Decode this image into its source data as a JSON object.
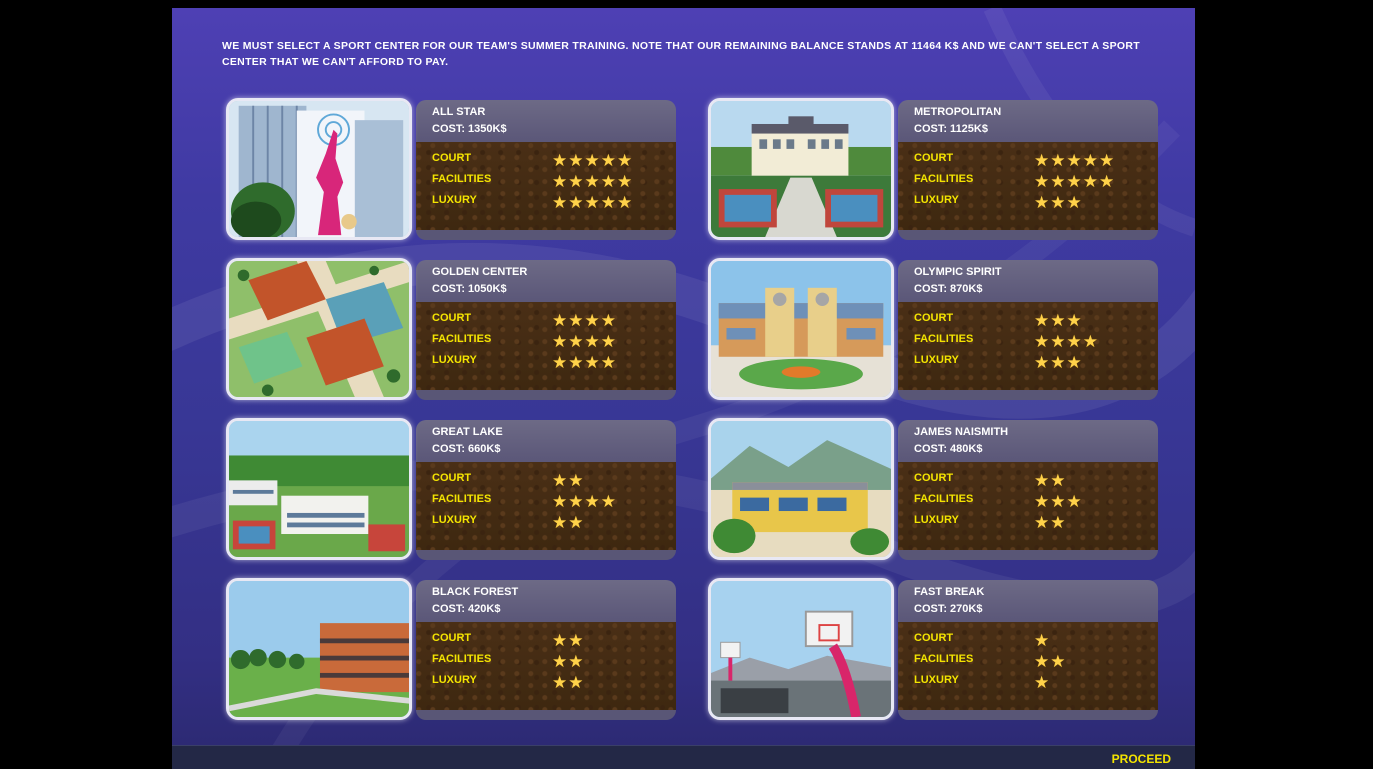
{
  "intro_text": "WE MUST SELECT A SPORT CENTER FOR OUR TEAM'S SUMMER TRAINING.  NOTE THAT OUR REMAINING BALANCE STANDS AT 11464 K$ AND WE CAN'T SELECT A SPORT CENTER THAT WE CAN'T AFFORD TO PAY.",
  "row_labels": {
    "court": "COURT",
    "facilities": "FACILITIES",
    "luxury": "LUXURY"
  },
  "centers": [
    {
      "name": "ALL STAR",
      "cost": "COST: 1350K$",
      "court": "★★★★★",
      "facilities": "★★★★★",
      "luxury": "★★★★★"
    },
    {
      "name": "METROPOLITAN",
      "cost": "COST: 1125K$",
      "court": "★★★★★",
      "facilities": "★★★★★",
      "luxury": "★★★"
    },
    {
      "name": "GOLDEN CENTER",
      "cost": "COST: 1050K$",
      "court": "★★★★",
      "facilities": "★★★★",
      "luxury": "★★★★"
    },
    {
      "name": "OLYMPIC SPIRIT",
      "cost": "COST: 870K$",
      "court": "★★★",
      "facilities": "★★★★",
      "luxury": "★★★"
    },
    {
      "name": "GREAT LAKE",
      "cost": "COST: 660K$",
      "court": "★★",
      "facilities": "★★★★",
      "luxury": "★★"
    },
    {
      "name": "JAMES NAISMITH",
      "cost": "COST: 480K$",
      "court": "★★",
      "facilities": "★★★",
      "luxury": "★★"
    },
    {
      "name": "BLACK FOREST",
      "cost": "COST: 420K$",
      "court": "★★",
      "facilities": "★★",
      "luxury": "★★"
    },
    {
      "name": "FAST BREAK",
      "cost": "COST: 270K$",
      "court": "★",
      "facilities": "★★",
      "luxury": "★"
    }
  ],
  "proceed_label": "PROCEED",
  "colors": {
    "label_yellow": "#f4e400",
    "star_gold": "#ffd24a",
    "background_purple": "#3f3aa2"
  }
}
